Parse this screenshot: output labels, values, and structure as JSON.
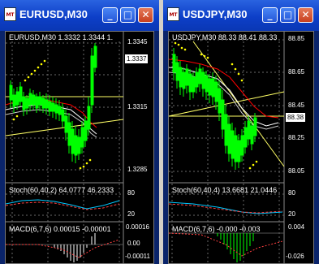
{
  "windows": [
    {
      "title": "EURUSD,M30",
      "icon_label": "MT",
      "buttons": {
        "minimize": "_",
        "maximize": "□",
        "close": "✕"
      },
      "header": "EURUSD,M30  1.3332 1.3344 1.",
      "price_ticks": [
        "1.3345",
        "1.3315",
        "1.3285"
      ],
      "current_price": "1.3337",
      "stoch_label": "Stoch(60,40,2) 64.0777 46.2333",
      "stoch_ticks": [
        "80",
        "20"
      ],
      "macd_label": "MACD(6,7,6) 0.00015 -0.00001",
      "macd_ticks": [
        "0.00016",
        "0.00",
        "-0.00011"
      ]
    },
    {
      "title": "USDJPY,M30",
      "icon_label": "MT",
      "buttons": {
        "minimize": "_",
        "maximize": "□",
        "close": "✕"
      },
      "header": "USDJPY,M30  88.33 88.41 88.33",
      "price_ticks": [
        "88.85",
        "88.65",
        "88.45",
        "88.25",
        "88.05"
      ],
      "current_price": "88.38",
      "stoch_label": "Stoch(60,40,4) 13.6681 21.0446",
      "stoch_ticks": [
        "80",
        "20"
      ],
      "macd_label": "MACD(6,7,6) -0.000 -0.003",
      "macd_ticks": [
        "0.004",
        "-0.026"
      ]
    }
  ],
  "colors": {
    "chart_bg": "#000000",
    "candles": "#00ff00",
    "ma_red": "#ff0000",
    "ma_white": "#ffffff",
    "trend_yellow": "#ffff66",
    "sar_dots": "#ffff00"
  }
}
